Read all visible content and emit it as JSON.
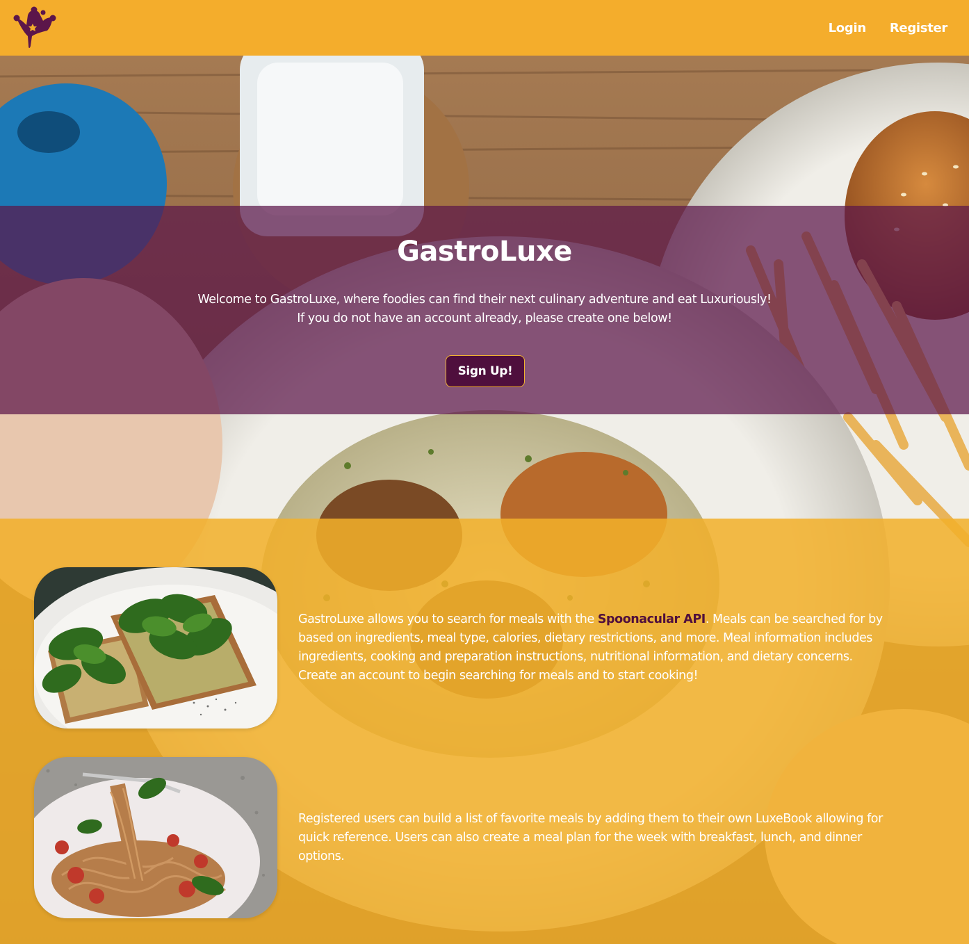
{
  "colors": {
    "brand_yellow": "#f4ad2c",
    "brand_plum": "#4f0f3d",
    "text_light": "#ffffff"
  },
  "navbar": {
    "logo_icon": "jester-hat-logo-icon",
    "links": [
      {
        "label": "Login"
      },
      {
        "label": "Register"
      }
    ]
  },
  "hero": {
    "title": "GastroLuxe",
    "text_line_1": "Welcome to GastroLuxe, where foodies can find their next culinary adventure and eat Luxuriously!",
    "text_line_2": "If you do not have an account already, please create one below!",
    "signup_label": "Sign Up!"
  },
  "features": [
    {
      "image": "avocado-toast-photo",
      "line_1_before": "GastroLuxe allows you to search for meals with the ",
      "link_label": "Spoonacular API",
      "line_1_after": ". Meals can be searched for by",
      "line_2": "based on ingredients, meal type, calories, dietary restrictions, and more. Meal information includes",
      "line_3": "ingredients, cooking and preparation instructions, nutritional information, and dietary concerns.",
      "line_4": "Create an account to begin searching for meals and to start cooking!"
    },
    {
      "image": "spaghetti-photo",
      "line_1": "Registered users can build a list of favorite meals by adding them to their own LuxeBook allowing for",
      "line_2": "quick reference. Users can also create a meal plan for the week with breakfast, lunch, and dinner",
      "line_3": "options."
    }
  ]
}
